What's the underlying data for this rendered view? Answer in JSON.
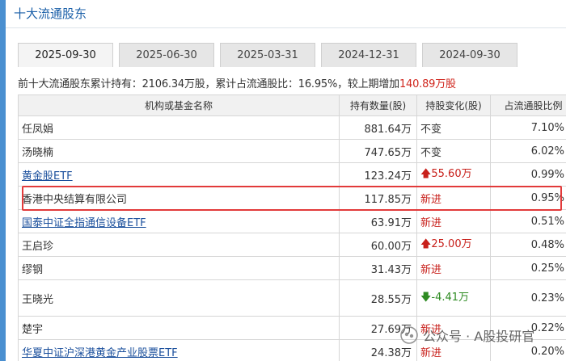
{
  "section": {
    "title": "十大流通股东"
  },
  "tabs": [
    {
      "label": "2025-09-30",
      "active": true
    },
    {
      "label": "2025-06-30",
      "active": false
    },
    {
      "label": "2025-03-31",
      "active": false
    },
    {
      "label": "2024-12-31",
      "active": false
    },
    {
      "label": "2024-09-30",
      "active": false
    }
  ],
  "summary": {
    "prefix": "前十大流通股东累计持有：2106.34万股，累计占流通股比：16.95%，较上期增加",
    "increase": "140.89万股"
  },
  "table": {
    "headers": [
      "机构或基金名称",
      "持有数量(股)",
      "持股变化(股)",
      "占流通股比例"
    ],
    "rows": [
      {
        "name": "任凤娟",
        "shares": "881.64万",
        "change": "不变",
        "change_type": "same",
        "ratio": "7.10%"
      },
      {
        "name": "汤晓楠",
        "shares": "747.65万",
        "change": "不变",
        "change_type": "same",
        "ratio": "6.02%"
      },
      {
        "name": "黄金股ETF",
        "shares": "123.24万",
        "change": "55.60万",
        "change_type": "up",
        "ratio": "0.99%",
        "link": true
      },
      {
        "name": "香港中央结算有限公司",
        "shares": "117.85万",
        "change": "新进",
        "change_type": "new",
        "ratio": "0.95%"
      },
      {
        "name": "国泰中证全指通信设备ETF",
        "shares": "63.91万",
        "change": "新进",
        "change_type": "new",
        "ratio": "0.51%",
        "link": true
      },
      {
        "name": "王启珍",
        "shares": "60.00万",
        "change": "25.00万",
        "change_type": "up",
        "ratio": "0.48%"
      },
      {
        "name": "缪钢",
        "shares": "31.43万",
        "change": "新进",
        "change_type": "new",
        "ratio": "0.25%"
      },
      {
        "name": "王晓光",
        "shares": "28.55万",
        "change": "-4.41万",
        "change_type": "down",
        "ratio": "0.23%"
      },
      {
        "name": "楚宇",
        "shares": "27.69万",
        "change": "新进",
        "change_type": "new",
        "ratio": "0.22%"
      },
      {
        "name": "华夏中证沪深港黄金产业股票ETF",
        "shares": "24.38万",
        "change": "新进",
        "change_type": "new",
        "ratio": "0.20%",
        "link": true
      }
    ]
  },
  "watermark": {
    "text": "公众号 · A股投研官"
  },
  "colors": {
    "accent": "#1a5fa8",
    "increase": "#c8201b",
    "decrease": "#2e8b22",
    "highlight": "#e23a3a"
  }
}
